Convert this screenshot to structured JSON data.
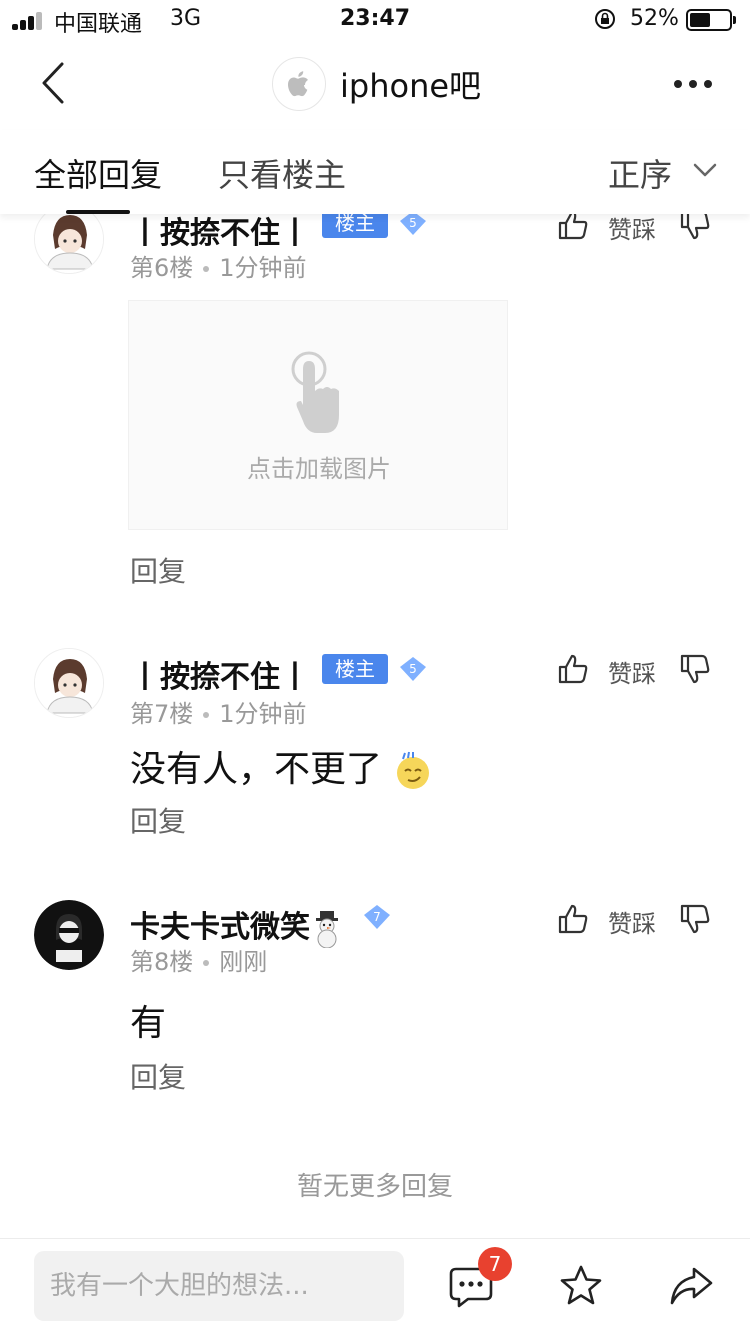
{
  "status_bar": {
    "carrier": "中国联通",
    "network": "3G",
    "time": "23:47",
    "battery": "52%"
  },
  "nav": {
    "forum_name": "iphone吧"
  },
  "tabs": {
    "all_replies": "全部回复",
    "owner_only": "只看楼主",
    "sort": "正序"
  },
  "posts": [
    {
      "username": "丨按捺不住丨",
      "owner_badge": "楼主",
      "level": "5",
      "floor": "第6楼",
      "time": "1分钟前",
      "image_placeholder": "点击加载图片",
      "like_label": "赞踩",
      "reply": "回复"
    },
    {
      "username": "丨按捺不住丨",
      "owner_badge": "楼主",
      "level": "5",
      "floor": "第7楼",
      "time": "1分钟前",
      "content": "没有人，不更了",
      "like_label": "赞踩",
      "reply": "回复"
    },
    {
      "username": "卡夫卡式微笑",
      "level": "7",
      "floor": "第8楼",
      "time": "刚刚",
      "content": "有",
      "like_label": "赞踩",
      "reply": "回复"
    }
  ],
  "no_more": "暂无更多回复",
  "bottom_bar": {
    "input_placeholder": "我有一个大胆的想法...",
    "comment_count": "7"
  },
  "colors": {
    "accent_blue": "#4a86ec",
    "level_diamond": "#7fb0ff",
    "badge_red": "#e8412f"
  },
  "icons": [
    "back-icon",
    "apple-logo-icon",
    "more-icon",
    "chevron-down-icon",
    "thumbs-up-icon",
    "thumbs-down-icon",
    "tap-hand-icon",
    "comment-icon",
    "star-icon",
    "share-icon"
  ]
}
